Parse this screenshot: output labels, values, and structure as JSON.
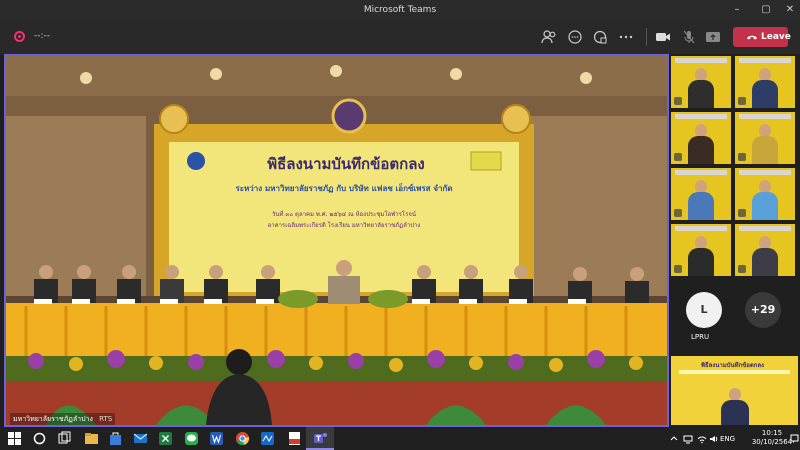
{
  "window": {
    "title": "Microsoft Teams"
  },
  "toolbar": {
    "recording_time": "--:--",
    "leave_label": "Leave"
  },
  "stage": {
    "banner_title": "พิธีลงนามบันทึกข้อตกลง",
    "banner_line1": "ระหว่าง มหาวิทยาลัยราชภัฏ กับ บริษัท แฟลช เอ็กซ์เพรส จำกัด",
    "banner_line2": "วันที่ ๓๐ ตุลาคม พ.ศ. ๒๕๖๔ ณ ห้องประชุมโอฬารโรจน์",
    "banner_line3": "อาคารเฉลิมพระเกียรติ โรงเรียน มหาวิทยาลัยราชภัฏลำปาง",
    "caption": "มหาวิทยาลัยราชภัฏลำปาง",
    "caption_tag": "RTS"
  },
  "side": {
    "avatar_l": "L",
    "avatar_l_name": "LPRU",
    "more_count": "+29",
    "bottom_tile_title": "พิธีลงนามบันทึกข้อตกลง"
  },
  "taskbar": {
    "lang": "ENG",
    "time": "10:15",
    "date": "30/10/2564"
  },
  "colors": {
    "accent": "#6d63d6",
    "leave": "#c4314b",
    "banner": "#f2e57a",
    "tile": "#e7c521"
  }
}
